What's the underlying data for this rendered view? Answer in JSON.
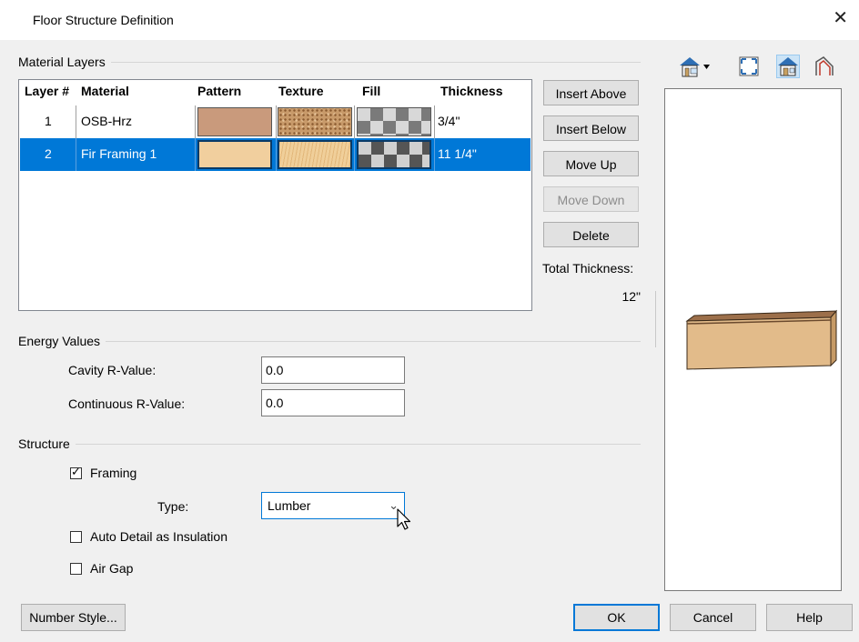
{
  "window": {
    "title": "Floor Structure Definition",
    "close": "✕"
  },
  "material_layers": {
    "group_label": "Material Layers",
    "columns": [
      "Layer #",
      "Material",
      "Pattern",
      "Texture",
      "Fill",
      "Thickness"
    ],
    "rows": [
      {
        "layer": "1",
        "material": "OSB-Hrz",
        "thickness": "3/4\"",
        "pattern_color": "#c99a7c",
        "selected": false
      },
      {
        "layer": "2",
        "material": "Fir Framing 1",
        "thickness": "11 1/4\"",
        "pattern_color": "#f1cf9e",
        "selected": true
      }
    ],
    "buttons": {
      "insert_above": "Insert Above",
      "insert_below": "Insert Below",
      "move_up": "Move Up",
      "move_down": "Move Down",
      "delete": "Delete"
    },
    "total_thickness_label": "Total Thickness:",
    "total_thickness_value": "12\""
  },
  "energy": {
    "group_label": "Energy Values",
    "cavity_label": "Cavity R-Value:",
    "cavity_value": "0.0",
    "continuous_label": "Continuous R-Value:",
    "continuous_value": "0.0"
  },
  "structure": {
    "group_label": "Structure",
    "framing_label": "Framing",
    "framing_checked": true,
    "type_label": "Type:",
    "type_value": "Lumber",
    "auto_detail_label": "Auto Detail as Insulation",
    "auto_detail_checked": false,
    "air_gap_label": "Air Gap",
    "air_gap_checked": false
  },
  "footer": {
    "number_style": "Number Style...",
    "ok": "OK",
    "cancel": "Cancel",
    "help": "Help"
  },
  "toolbar_icons": [
    "view-options-icon",
    "fill-window-icon",
    "render-preview-icon",
    "profile-view-icon"
  ],
  "colors": {
    "selection": "#0078d7",
    "osb": "#c99a7c",
    "fir": "#f1cf9e"
  }
}
